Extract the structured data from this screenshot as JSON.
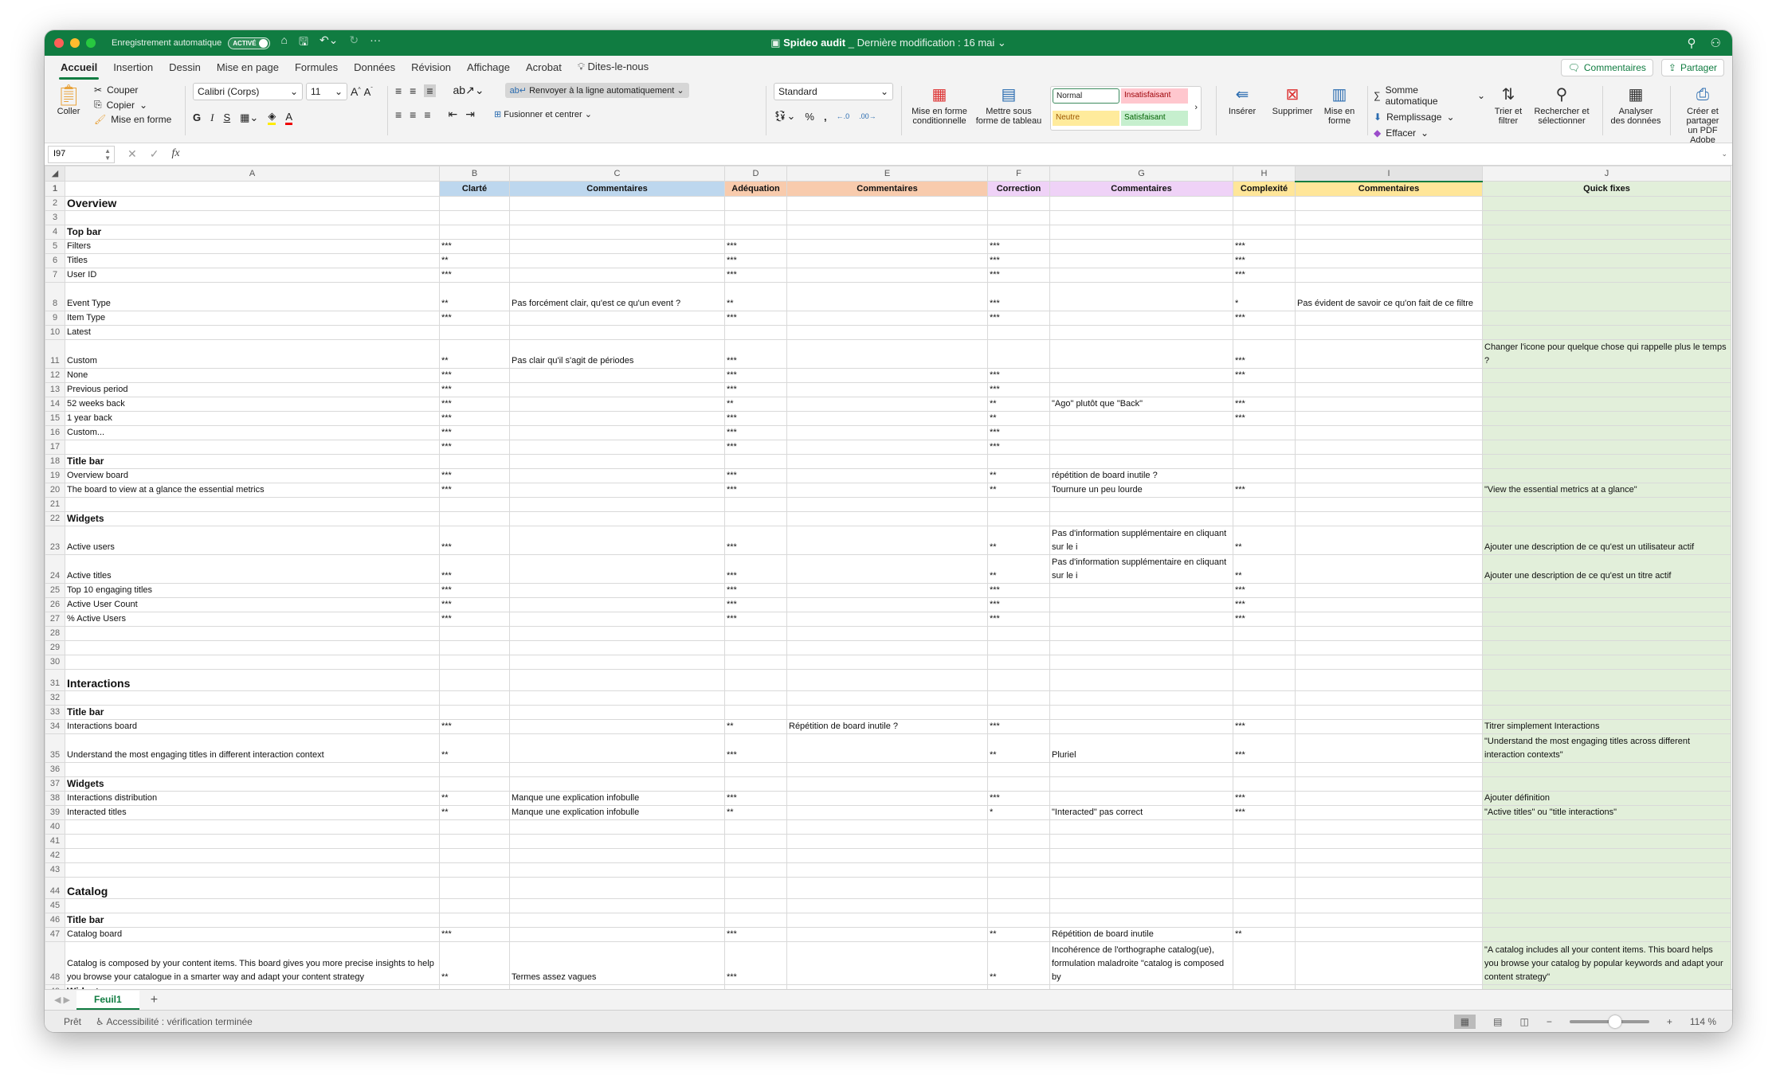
{
  "titlebar": {
    "autosave_label": "Enregistrement automatique",
    "autosave_state": "ACTIVÉ",
    "doc_name": "Spideo audit",
    "doc_modified": "_ Dernière modification : 16 mai",
    "more": "···",
    "colors": {
      "brand": "#107c41"
    }
  },
  "menu": {
    "tabs": [
      "Accueil",
      "Insertion",
      "Dessin",
      "Mise en page",
      "Formules",
      "Données",
      "Révision",
      "Affichage",
      "Acrobat",
      "Dites-le-nous"
    ],
    "active_tab": "Accueil",
    "comments_label": "Commentaires",
    "share_label": "Partager"
  },
  "ribbon": {
    "paste": "Coller",
    "cut": "Couper",
    "copy": "Copier",
    "format_painter": "Mise en forme",
    "font_name": "Calibri (Corps)",
    "font_size": "11",
    "bold": "G",
    "italic": "I",
    "underline": "S",
    "wrap_text": "Renvoyer à la ligne automatiquement",
    "merge_center": "Fusionner et centrer",
    "number_format": "Standard",
    "conditional_format": [
      "Mise en forme",
      "conditionnelle"
    ],
    "format_table": [
      "Mettre sous",
      "forme de tableau"
    ],
    "styles": {
      "normal": "Normal",
      "bad": "Insatisfaisant",
      "neutral": "Neutre",
      "good": "Satisfaisant"
    },
    "insert": "Insérer",
    "delete": "Supprimer",
    "format": [
      "Mise en",
      "forme"
    ],
    "autosum": "Somme automatique",
    "fill": "Remplissage",
    "clear": "Effacer",
    "sort_filter": [
      "Trier et",
      "filtrer"
    ],
    "find_select": [
      "Rechercher et",
      "sélectionner"
    ],
    "analyze": [
      "Analyser",
      "des données"
    ],
    "create_pdf": [
      "Créer et partager",
      "un PDF Adobe"
    ]
  },
  "formula_bar": {
    "cell_ref": "I97",
    "formula": ""
  },
  "sheet": {
    "columns": [
      "A",
      "B",
      "C",
      "D",
      "E",
      "F",
      "G",
      "H",
      "I",
      "J"
    ],
    "selected_column": "I",
    "header_row": [
      "",
      "Clarté",
      "Commentaires",
      "Adéquation",
      "Commentaires",
      "Correction",
      "Commentaires",
      "Complexité",
      "Commentaires",
      "Quick fixes"
    ],
    "rows": [
      {
        "n": "2",
        "A": "Overview",
        "style": "h1"
      },
      {
        "n": "3"
      },
      {
        "n": "4",
        "A": "Top bar",
        "style": "h2"
      },
      {
        "n": "5",
        "A": "Filters",
        "B": "***",
        "D": "***",
        "F": "***",
        "H": "***"
      },
      {
        "n": "6",
        "A": "Titles",
        "B": "**",
        "D": "***",
        "F": "***",
        "H": "***"
      },
      {
        "n": "7",
        "A": "User ID",
        "B": "***",
        "D": "***",
        "F": "***",
        "H": "***"
      },
      {
        "n": "8",
        "A": "Event Type",
        "B": "**",
        "C": "Pas forcément clair, qu'est ce qu'un event ?",
        "D": "**",
        "F": "***",
        "H": "*",
        "I": "Pas évident de savoir ce qu'on fait de ce filtre",
        "tall": 2
      },
      {
        "n": "9",
        "A": "Item Type",
        "B": "***",
        "D": "***",
        "F": "***",
        "H": "***"
      },
      {
        "n": "10",
        "A": "Latest"
      },
      {
        "n": "11",
        "A": "Custom",
        "B": "**",
        "C": "Pas clair qu'il s'agit de périodes",
        "D": "***",
        "H": "***",
        "J": "Changer l'icone pour quelque chose qui rappelle plus le temps ?",
        "tall": 2
      },
      {
        "n": "12",
        "A": "None",
        "B": "***",
        "D": "***",
        "F": "***",
        "H": "***"
      },
      {
        "n": "13",
        "A": "Previous period",
        "B": "***",
        "D": "***",
        "F": "***"
      },
      {
        "n": "14",
        "A": "52 weeks back",
        "B": "***",
        "D": "**",
        "F": "**",
        "G": "\"Ago\" plutôt que \"Back\"",
        "H": "***"
      },
      {
        "n": "15",
        "A": "1 year back",
        "B": "***",
        "D": "***",
        "F": "**",
        "H": "***"
      },
      {
        "n": "16",
        "A": "Custom...",
        "B": "***",
        "D": "***",
        "F": "***"
      },
      {
        "n": "17",
        "B": "***",
        "D": "***",
        "F": "***"
      },
      {
        "n": "18",
        "A": "Title bar",
        "style": "h2"
      },
      {
        "n": "19",
        "A": "Overview board",
        "B": "***",
        "D": "***",
        "F": "**",
        "G": "répétition de board inutile ?"
      },
      {
        "n": "20",
        "A": "The board to view at a glance the essential metrics",
        "B": "***",
        "D": "***",
        "F": "**",
        "G": "Tournure un peu lourde",
        "H": "***",
        "J": "\"View the essential metrics at a glance\""
      },
      {
        "n": "21"
      },
      {
        "n": "22",
        "A": "Widgets",
        "style": "h2"
      },
      {
        "n": "23",
        "A": "Active users",
        "B": "***",
        "D": "***",
        "F": "**",
        "G": "Pas d'information supplémentaire en cliquant sur le i",
        "H": "**",
        "J": "Ajouter une description de ce qu'est un utilisateur actif",
        "tall": 2
      },
      {
        "n": "24",
        "A": "Active titles",
        "B": "***",
        "D": "***",
        "F": "**",
        "G": "Pas d'information supplémentaire en cliquant sur le i",
        "H": "**",
        "J": "Ajouter une description de ce qu'est un titre actif",
        "tall": 2
      },
      {
        "n": "25",
        "A": "Top 10 engaging titles",
        "B": "***",
        "D": "***",
        "F": "***",
        "H": "***"
      },
      {
        "n": "26",
        "A": "Active User Count",
        "B": "***",
        "D": "***",
        "F": "***",
        "H": "***"
      },
      {
        "n": "27",
        "A": "% Active Users",
        "B": "***",
        "D": "***",
        "F": "***",
        "H": "***"
      },
      {
        "n": "28"
      },
      {
        "n": "29"
      },
      {
        "n": "30"
      },
      {
        "n": "31",
        "A": "Interactions",
        "style": "h1",
        "tall": 1.5
      },
      {
        "n": "32"
      },
      {
        "n": "33",
        "A": "Title bar",
        "style": "h2"
      },
      {
        "n": "34",
        "A": "Interactions board",
        "B": "***",
        "D": "**",
        "E": "Répétition de board inutile ?",
        "F": "***",
        "H": "***",
        "J": "Titrer simplement Interactions"
      },
      {
        "n": "35",
        "A": "Understand the most engaging titles in different interaction context",
        "B": "**",
        "D": "***",
        "F": "**",
        "G": "Pluriel",
        "H": "***",
        "J": "\"Understand the most engaging titles across different interaction contexts\"",
        "tall": 2
      },
      {
        "n": "36"
      },
      {
        "n": "37",
        "A": "Widgets",
        "style": "h2"
      },
      {
        "n": "38",
        "A": "Interactions distribution",
        "B": "**",
        "C": "Manque une explication infobulle",
        "D": "***",
        "F": "***",
        "H": "***",
        "J": "Ajouter définition"
      },
      {
        "n": "39",
        "A": "Interacted titles",
        "B": "**",
        "C": "Manque une explication infobulle",
        "D": "**",
        "F": "*",
        "G": "\"Interacted\" pas correct",
        "H": "***",
        "J": "\"Active titles\" ou \"title interactions\""
      },
      {
        "n": "40"
      },
      {
        "n": "41"
      },
      {
        "n": "42"
      },
      {
        "n": "43"
      },
      {
        "n": "44",
        "A": "Catalog",
        "style": "h1",
        "tall": 1.5
      },
      {
        "n": "45"
      },
      {
        "n": "46",
        "A": "Title bar",
        "style": "h2"
      },
      {
        "n": "47",
        "A": "Catalog board",
        "B": "***",
        "D": "***",
        "F": "**",
        "G": "Répétition de board inutile",
        "H": "**"
      },
      {
        "n": "48",
        "A": "Catalog is composed by your content items. This board gives you more precise insights to help you browse your catalogue in a smarter way and adapt your content strategy",
        "B": "**",
        "C": "Termes assez vagues",
        "D": "***",
        "F": "**",
        "G": "Incohérence de l'orthographe catalog(ue), formulation maladroite \"catalog is composed by",
        "J": "\"A catalog includes all your content items. This board helps you browse your catalog by popular keywords and adapt your content strategy\"",
        "tall": 3
      },
      {
        "n": "49",
        "A": "Widgets",
        "style": "h2"
      }
    ]
  },
  "sheet_tabs": {
    "active": "Feuil1",
    "add": "+"
  },
  "status": {
    "ready": "Prêt",
    "accessibility": "Accessibilité : vérification terminée",
    "zoom": "114 %",
    "zoom_level": 0.57
  }
}
